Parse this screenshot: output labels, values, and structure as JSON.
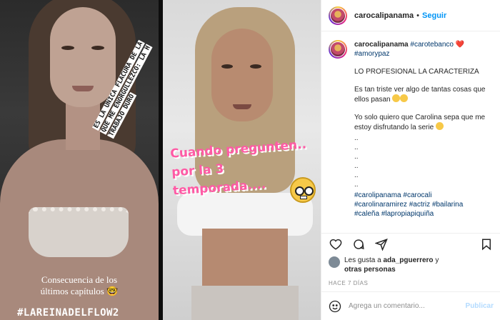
{
  "post": {
    "username": "carocalipanama",
    "dot": "•",
    "follow_label": "Seguir"
  },
  "media": {
    "left_story_lines": [
      "ES LA ÚNICA FLACURA DE LA",
      "QUE ME ENORGULLEZCO: LA H",
      "TRABAJO DURO"
    ],
    "left_caption_1": "Consecuencia de los",
    "left_caption_2": "últimos capítulos 🤓",
    "left_hashtag": "#LAREINADELFLOW2",
    "right_pink_lines": [
      "Cuando pregunten..",
      "por la 3",
      "temporada...."
    ]
  },
  "caption": {
    "username": "carocalipanama",
    "tag1": "#carotebanco",
    "heart": "❤️",
    "tag2": "#amorypaz",
    "line1": "LO PROFESIONAL LA CARACTERIZA",
    "line2": "Es tan triste ver algo de tantas cosas que ellos pasan",
    "line3": "Yo solo quiero que Carolina sepa que me estoy disfrutando la serie",
    "dots": [
      "..",
      "..",
      "..",
      "..",
      "..",
      ".."
    ],
    "tags": [
      "#carolipanama",
      "#carocali",
      "#carolinaramirez",
      "#actriz",
      "#bailarina",
      "#caleña",
      "#lapropiapiquiña"
    ]
  },
  "likes": {
    "prefix": "Les gusta a",
    "user": "ada_pguerrero",
    "conjunction": "y",
    "others": "otras personas"
  },
  "date": "HACE 7 DÍAS",
  "comment_box": {
    "placeholder": "Agrega un comentario...",
    "publish_label": "Publicar"
  },
  "icons": [
    "heart-icon",
    "comment-icon",
    "share-icon",
    "bookmark-icon",
    "smile-icon"
  ]
}
